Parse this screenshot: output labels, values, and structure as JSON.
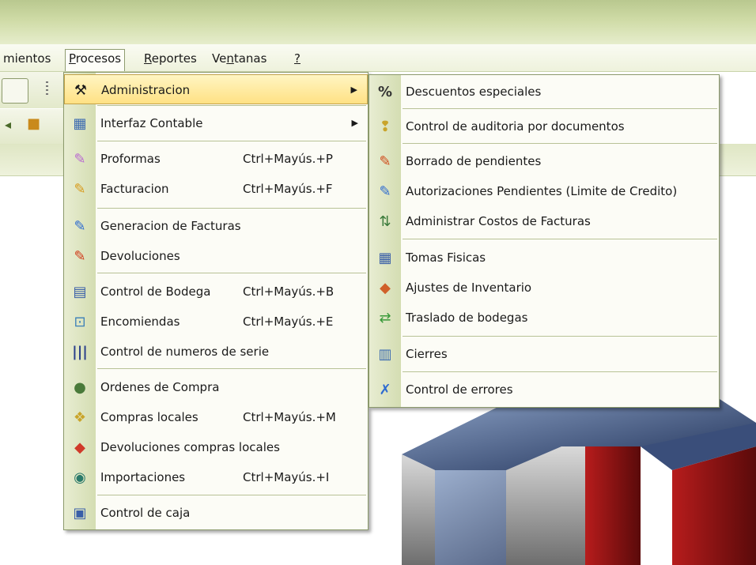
{
  "menubar": {
    "items": [
      {
        "label": "mientos"
      },
      {
        "label": "Procesos"
      },
      {
        "label": "Reportes"
      },
      {
        "label": "Ventanas"
      },
      {
        "label": "?"
      }
    ]
  },
  "procesos_menu": {
    "items": [
      {
        "label": "Administracion",
        "shortcut": "",
        "submenu": true,
        "icon": "tools-icon"
      },
      {
        "label": "Interfaz Contable",
        "shortcut": "",
        "submenu": true,
        "icon": "accounting-icon"
      },
      {
        "label": "Proformas",
        "shortcut": "Ctrl+Mayús.+P",
        "icon": "proforma-icon"
      },
      {
        "label": "Facturacion",
        "shortcut": "Ctrl+Mayús.+F",
        "icon": "invoice-icon"
      },
      {
        "label": "Generacion de Facturas",
        "shortcut": "",
        "icon": "generate-invoice-icon"
      },
      {
        "label": "Devoluciones",
        "shortcut": "",
        "icon": "returns-icon"
      },
      {
        "label": "Control de Bodega",
        "shortcut": "Ctrl+Mayús.+B",
        "icon": "warehouse-icon"
      },
      {
        "label": "Encomiendas",
        "shortcut": "Ctrl+Mayús.+E",
        "icon": "parcel-icon"
      },
      {
        "label": "Control de numeros de serie",
        "shortcut": "",
        "icon": "barcode-icon"
      },
      {
        "label": "Ordenes de Compra",
        "shortcut": "",
        "icon": "purchase-order-icon"
      },
      {
        "label": "Compras locales",
        "shortcut": "Ctrl+Mayús.+M",
        "icon": "local-purchase-icon"
      },
      {
        "label": "Devoluciones compras locales",
        "shortcut": "",
        "icon": "purchase-return-icon"
      },
      {
        "label": "Importaciones",
        "shortcut": "Ctrl+Mayús.+I",
        "icon": "globe-icon"
      },
      {
        "label": "Control de caja",
        "shortcut": "",
        "icon": "cash-register-icon"
      }
    ]
  },
  "admin_submenu": {
    "items": [
      {
        "label": "Descuentos especiales",
        "icon": "percent-icon"
      },
      {
        "label": "Control de auditoria por documentos",
        "icon": "audit-icon"
      },
      {
        "label": "Borrado de pendientes",
        "icon": "delete-pending-icon"
      },
      {
        "label": "Autorizaciones Pendientes (Limite de Credito)",
        "icon": "authorization-icon"
      },
      {
        "label": "Administrar Costos de Facturas",
        "icon": "costs-icon"
      },
      {
        "label": "Tomas Fisicas",
        "icon": "physical-count-icon"
      },
      {
        "label": "Ajustes de Inventario",
        "icon": "inventory-adjust-icon"
      },
      {
        "label": "Traslado de bodegas",
        "icon": "transfer-icon"
      },
      {
        "label": "Cierres",
        "icon": "closing-icon"
      },
      {
        "label": "Control de errores",
        "icon": "error-control-icon"
      }
    ]
  },
  "colors": {
    "highlight": "#ffe184",
    "menu_bg": "#fcfcf6",
    "gutter": "#d4ddb2",
    "border": "#8c9a6c"
  }
}
